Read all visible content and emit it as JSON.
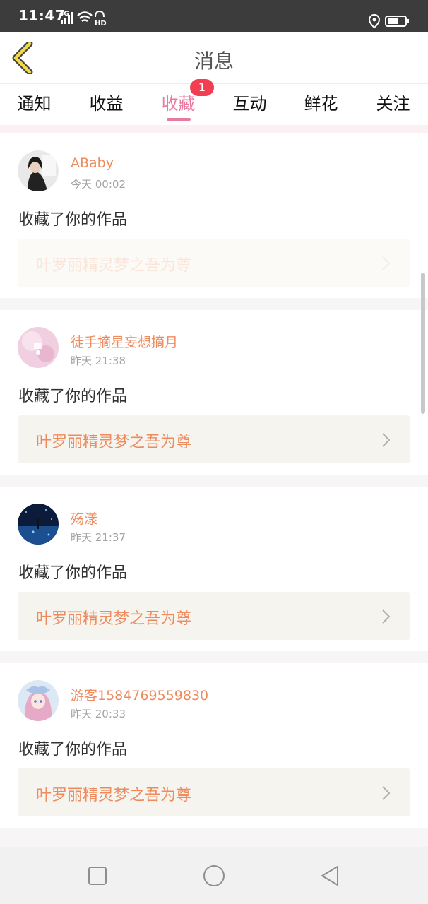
{
  "status_bar": {
    "time": "11:47",
    "network": "4G",
    "hd": "HD",
    "icons": [
      "signal-icon",
      "wifi-icon",
      "location-icon",
      "battery-icon"
    ]
  },
  "header": {
    "title": "消息",
    "back_icon": "back-chevron-icon"
  },
  "tabs": [
    {
      "label": "通知"
    },
    {
      "label": "收益"
    },
    {
      "label": "收藏"
    },
    {
      "label": "互动"
    },
    {
      "label": "鲜花"
    },
    {
      "label": "关注"
    }
  ],
  "active_tab_index": 2,
  "badge": "1",
  "messages": [
    {
      "user": "ABaby",
      "time": "今天 00:02",
      "action": "收藏了你的作品",
      "work": "叶罗丽精灵梦之吾为尊"
    },
    {
      "user": "徒手摘星妄想摘月",
      "time": "昨天 21:38",
      "action": "收藏了你的作品",
      "work": "叶罗丽精灵梦之吾为尊"
    },
    {
      "user": "殇漾",
      "time": "昨天 21:37",
      "action": "收藏了你的作品",
      "work": "叶罗丽精灵梦之吾为尊"
    },
    {
      "user": "游客1584769559830",
      "time": "昨天 20:33",
      "action": "收藏了你的作品",
      "work": "叶罗丽精灵梦之吾为尊"
    }
  ],
  "colors": {
    "accent_pink": "#e8799f",
    "username_orange": "#ee8b5e",
    "badge_red": "#f23d52"
  },
  "nav_icons": [
    "recents-square-icon",
    "home-circle-icon",
    "back-triangle-icon"
  ]
}
